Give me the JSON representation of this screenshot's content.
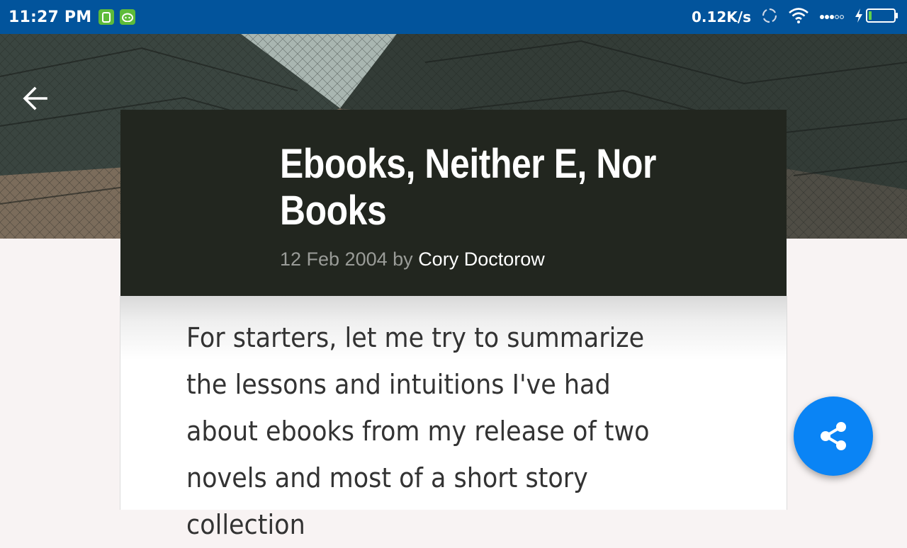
{
  "status_bar": {
    "time": "11:27 PM",
    "net_speed": "0.12K/s",
    "icons": [
      "sim-notification-icon",
      "android-notification-icon",
      "sync-icon",
      "wifi-icon",
      "signal-icon",
      "charging-icon",
      "battery-icon"
    ],
    "background_color": "#02549c"
  },
  "toolbar": {
    "back_icon": "arrow-left-icon"
  },
  "article": {
    "title": "Ebooks, Neither E, Nor Books",
    "date": "12 Feb 2004",
    "by": "by",
    "author": "Cory Doctorow",
    "body": "For starters, let me try to summarize the lessons and intuitions I've had about ebooks from my release of two novels and most of a short story collection"
  },
  "fab": {
    "icon": "share-icon",
    "color": "#0a84f5"
  }
}
